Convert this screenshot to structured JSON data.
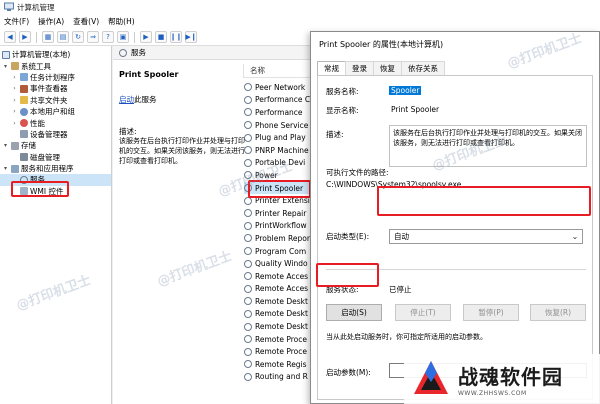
{
  "window": {
    "title": "计算机管理"
  },
  "menu": [
    "文件(F)",
    "操作(A)",
    "查看(V)",
    "帮助(H)"
  ],
  "tree": {
    "items": [
      {
        "label": "计算机管理(本地)",
        "level": 0,
        "arrow": ""
      },
      {
        "label": "系统工具",
        "level": 1,
        "arrow": "v"
      },
      {
        "label": "任务计划程序",
        "level": 2,
        "arrow": ">"
      },
      {
        "label": "事件查看器",
        "level": 2,
        "arrow": ">"
      },
      {
        "label": "共享文件夹",
        "level": 2,
        "arrow": ">"
      },
      {
        "label": "本地用户和组",
        "level": 2,
        "arrow": ">"
      },
      {
        "label": "性能",
        "level": 2,
        "arrow": ">"
      },
      {
        "label": "设备管理器",
        "level": 2,
        "arrow": ""
      },
      {
        "label": "存储",
        "level": 1,
        "arrow": "v"
      },
      {
        "label": "磁盘管理",
        "level": 2,
        "arrow": ""
      },
      {
        "label": "服务和应用程序",
        "level": 1,
        "arrow": "v"
      },
      {
        "label": "服务",
        "level": 2,
        "arrow": ""
      },
      {
        "label": "WMI 控件",
        "level": 2,
        "arrow": ""
      }
    ]
  },
  "services": {
    "header": "服务",
    "selected_name": "Print Spooler",
    "start_link": "启动",
    "start_suffix": "此服务",
    "desc_label": "描述:",
    "desc_text": "该服务在后台执行打印作业并处理与打印机的交互。如果关闭该服务，则无法进行打印或查看打印机。",
    "column_name": "名称",
    "list": [
      "Peer Network",
      "Performance C",
      "Performance",
      "Phone Service",
      "Plug and Play",
      "PNRP Machine",
      "Portable Devi",
      "Power",
      "Print Spooler",
      "Printer Extensi",
      "Printer Repair",
      "PrintWorkflow",
      "Problem Repor",
      "Program Com",
      "Quality Windo",
      "Remote Acces",
      "Remote Acces",
      "Remote Deskt",
      "Remote Deskt",
      "Remote Deskt",
      "Remote Proce",
      "Remote Proce",
      "Remote Regis",
      "Routing and R"
    ]
  },
  "dialog": {
    "title": "Print Spooler 的属性(本地计算机)",
    "tabs": [
      "常规",
      "登录",
      "恢复",
      "依存关系"
    ],
    "service_name_label": "服务名称:",
    "service_name_value": "Spooler",
    "display_name_label": "显示名称:",
    "display_name_value": "Print Spooler",
    "desc_label": "描述:",
    "desc_value": "该服务在后台执行打印作业并处理与打印机的交互。如果关闭该服务，则无法进行打印或查看打印机。",
    "exe_path_label": "可执行文件的路径:",
    "exe_path_value": "C:\\WINDOWS\\System32\\spoolsv.exe",
    "startup_type_label": "启动类型(E):",
    "startup_type_value": "自动",
    "status_label": "服务状态:",
    "status_value": "已停止",
    "buttons": {
      "start": "启动(S)",
      "stop": "停止(T)",
      "pause": "暂停(P)",
      "resume": "恢复(R)"
    },
    "hint": "当从此处启动服务时，你可指定所适用的启动参数。",
    "param_label": "启动参数(M):"
  },
  "watermarks": [
    "@打印机卫士",
    "@打印机卫士",
    "@打印机卫士",
    "@打印机卫士",
    "@打印机卫士"
  ],
  "branding": {
    "name": "战魂软件园",
    "url": "WWW.ZHHSWS.COM"
  },
  "colors": {
    "highlight": "#0078d7",
    "annotation": "#e81d24",
    "link": "#1a4fbf"
  }
}
